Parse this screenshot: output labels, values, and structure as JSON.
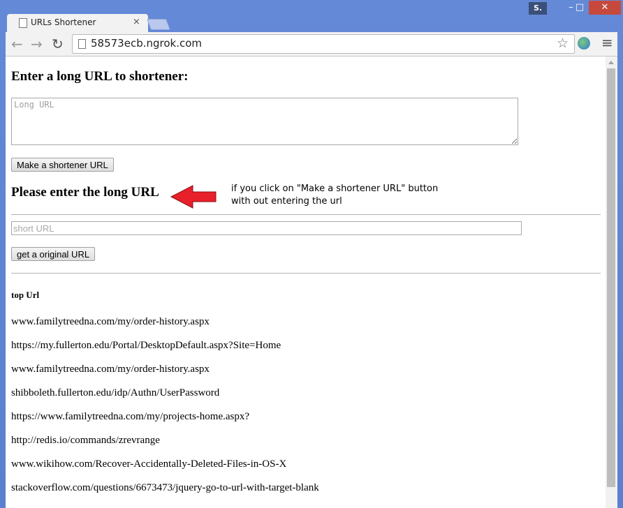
{
  "browser": {
    "user_badge": "S.",
    "controls": {
      "minimize": "–",
      "maximize": "□",
      "close": "✕"
    },
    "tab": {
      "title": "URLs Shortener",
      "close": "×"
    },
    "nav": {
      "back": "←",
      "forward": "→",
      "reload": "↻",
      "menu": "≡",
      "star": "☆"
    },
    "address": "58573ecb.ngrok.com"
  },
  "page": {
    "heading": "Enter a long URL to shortener:",
    "long_url_placeholder": "Long URL",
    "make_button": "Make a shortener URL",
    "error_message": "Please enter the long URL",
    "annotation_line1": "if you click on \"Make a shortener URL\" button",
    "annotation_line2": "with out entering the url",
    "short_url_placeholder": "short URL",
    "original_button": "get a original URL",
    "top_label": "top Url",
    "top_urls": [
      "www.familytreedna.com/my/order-history.aspx",
      "https://my.fullerton.edu/Portal/DesktopDefault.aspx?Site=Home",
      "www.familytreedna.com/my/order-history.aspx",
      "shibboleth.fullerton.edu/idp/Authn/UserPassword",
      "https://www.familytreedna.com/my/projects-home.aspx?",
      "http://redis.io/commands/zrevrange",
      "www.wikihow.com/Recover-Accidentally-Deleted-Files-in-OS-X",
      "stackoverflow.com/questions/6673473/jquery-go-to-url-with-target-blank"
    ]
  },
  "colors": {
    "arrow": "#e8202a",
    "close_button": "#c7493d",
    "frame": "#5b80cf"
  }
}
